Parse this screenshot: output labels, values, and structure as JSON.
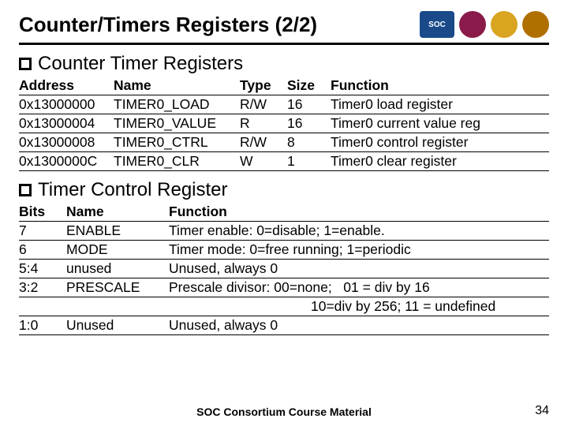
{
  "title": "Counter/Timers Registers (2/2)",
  "section1": "Counter Timer Registers",
  "t1": {
    "h": {
      "c0": "Address",
      "c1": "Name",
      "c2": "Type",
      "c3": "Size",
      "c4": "Function"
    },
    "r": [
      {
        "c0": "0x13000000",
        "c1": "TIMER0_LOAD",
        "c2": "R/W",
        "c3": "16",
        "c4": "Timer0 load register"
      },
      {
        "c0": "0x13000004",
        "c1": "TIMER0_VALUE",
        "c2": "R",
        "c3": "16",
        "c4": "Timer0 current value reg"
      },
      {
        "c0": "0x13000008",
        "c1": "TIMER0_CTRL",
        "c2": "R/W",
        "c3": "8",
        "c4": "Timer0 control register"
      },
      {
        "c0": "0x1300000C",
        "c1": "TIMER0_CLR",
        "c2": "W",
        "c3": "1",
        "c4": "Timer0 clear register"
      }
    ]
  },
  "section2": "Timer Control Register",
  "t2": {
    "h": {
      "c0": "Bits",
      "c1": "Name",
      "c2": "Function"
    },
    "r": [
      {
        "c0": "7",
        "c1": "ENABLE",
        "c2": "Timer enable: 0=disable; 1=enable."
      },
      {
        "c0": "6",
        "c1": "MODE",
        "c2": "Timer mode: 0=free running; 1=periodic"
      },
      {
        "c0": "5:4",
        "c1": "unused",
        "c2": "Unused, always 0"
      },
      {
        "c0": "3:2",
        "c1": "PRESCALE",
        "c2": "Prescale divisor: 00=none;   01 = div by 16"
      },
      {
        "c0": "",
        "c1": "",
        "c2": "10=div by 256; 11 = undefined",
        "indent": true
      },
      {
        "c0": "1:0",
        "c1": "Unused",
        "c2": "Unused, always 0"
      }
    ]
  },
  "footer": "SOC Consortium Course Material",
  "page": "34",
  "logos": {
    "soc": "SOC"
  }
}
